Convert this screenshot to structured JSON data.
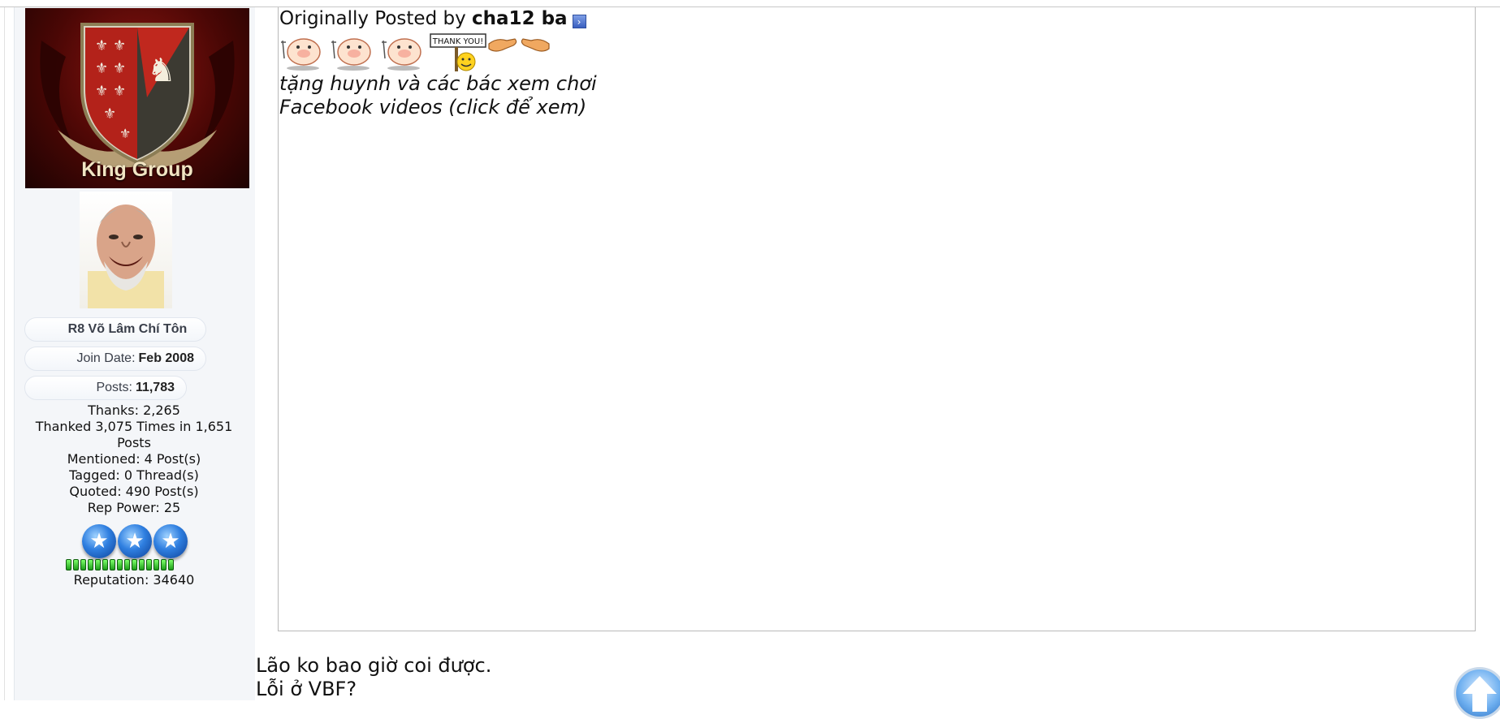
{
  "sidebar": {
    "banner_text": "King Group",
    "rank": "R8 Võ Lâm Chí Tôn",
    "join_label": "Join Date:",
    "join_value": "Feb 2008",
    "posts_label": "Posts:",
    "posts_value": "11,783",
    "thanks": "Thanks: 2,265",
    "thanked": "Thanked 3,075 Times in 1,651 Posts",
    "mentioned": "Mentioned: 4 Post(s)",
    "tagged": "Tagged: 0 Thread(s)",
    "quoted": "Quoted: 490 Post(s)",
    "rep_power": "Rep Power: 25",
    "reputation": "Reputation: 34640",
    "rep_star_count": 3,
    "rep_bar_segments": 15
  },
  "quote": {
    "prefix": "Originally Posted by",
    "author": "cha12 ba",
    "thank_you_sign": "THANK YOU!",
    "line1": "tặng huynh và các bác xem chơi",
    "line2": "Facebook videos (click để xem)"
  },
  "post": {
    "line1": "Lão ko bao giờ coi được.",
    "line2": "Lỗi ở VBF?"
  },
  "colors": {
    "sidebar_bg": "#f4f6f9",
    "rep_green": "#1d9e19",
    "star_blue": "#2f7fe0"
  }
}
